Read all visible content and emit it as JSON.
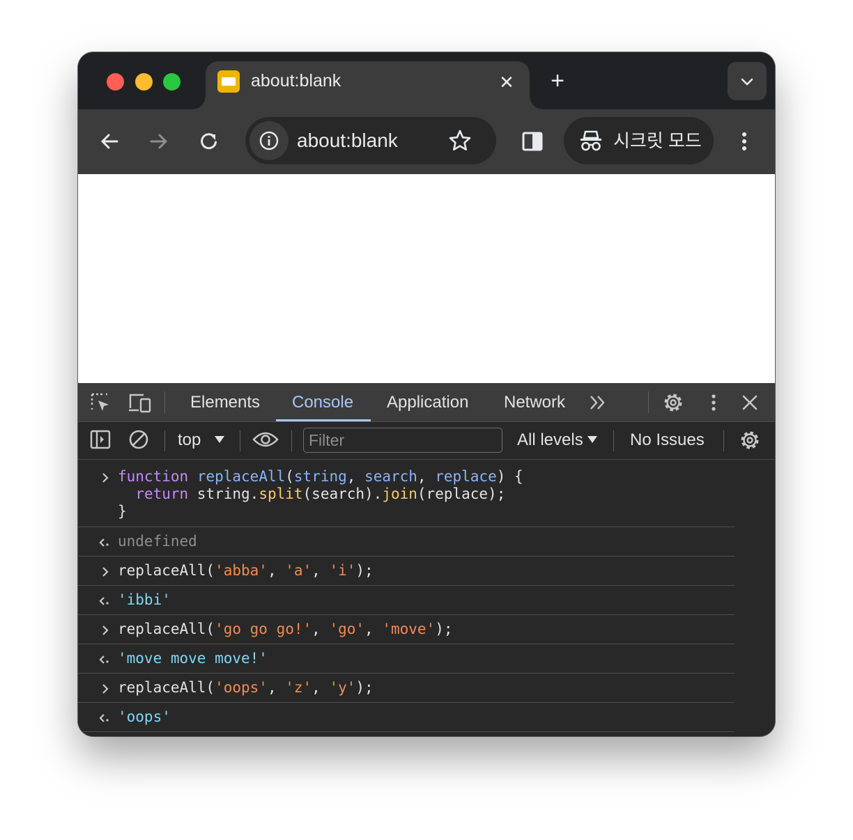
{
  "browser": {
    "tab": {
      "title": "about:blank",
      "close_glyph": "✕",
      "favicon": "page-favicon"
    },
    "new_tab_glyph": "+",
    "omnibox": {
      "url": "about:blank"
    },
    "incognito_label": "시크릿 모드",
    "icons": [
      "back-icon",
      "forward-icon",
      "reload-icon",
      "info-icon",
      "star-icon",
      "side-panel-icon",
      "incognito-icon",
      "more-vert-icon",
      "chevron-down-icon"
    ]
  },
  "devtools": {
    "tabs": [
      {
        "label": "Elements"
      },
      {
        "label": "Console",
        "active": true
      },
      {
        "label": "Application"
      },
      {
        "label": "Network"
      }
    ],
    "console_toolbar": {
      "context": "top",
      "filter_placeholder": "Filter",
      "levels": "All levels",
      "issues": "No Issues"
    },
    "colors": {
      "keyword": "#c58af9",
      "identifier": "#8ab4f8",
      "method": "#f9cb70",
      "string": "#f28b54",
      "result_string": "#80d7f8",
      "undefined": "#8e8e8e",
      "active_tab": "#a8c7fa"
    },
    "console": {
      "entries": [
        {
          "kind": "input",
          "lines": [
            [
              {
                "t": "function",
                "c": "kw"
              },
              {
                "t": " "
              },
              {
                "t": "replaceAll",
                "c": "fn"
              },
              {
                "t": "("
              },
              {
                "t": "string",
                "c": "param"
              },
              {
                "t": ", "
              },
              {
                "t": "search",
                "c": "param"
              },
              {
                "t": ", "
              },
              {
                "t": "replace",
                "c": "param"
              },
              {
                "t": ") {"
              }
            ],
            [
              {
                "t": "  "
              },
              {
                "t": "return",
                "c": "kw"
              },
              {
                "t": " string."
              },
              {
                "t": "split",
                "c": "call"
              },
              {
                "t": "(search)."
              },
              {
                "t": "join",
                "c": "call"
              },
              {
                "t": "(replace);"
              }
            ],
            [
              {
                "t": "}"
              }
            ]
          ]
        },
        {
          "kind": "output",
          "lines": [
            [
              {
                "t": "undefined",
                "c": "undef"
              }
            ]
          ]
        },
        {
          "kind": "input",
          "lines": [
            [
              {
                "t": "replaceAll("
              },
              {
                "t": "'abba'",
                "c": "str"
              },
              {
                "t": ", "
              },
              {
                "t": "'a'",
                "c": "str"
              },
              {
                "t": ", "
              },
              {
                "t": "'i'",
                "c": "str"
              },
              {
                "t": ");"
              }
            ]
          ]
        },
        {
          "kind": "output",
          "lines": [
            [
              {
                "t": "'ibbi'",
                "c": "res"
              }
            ]
          ]
        },
        {
          "kind": "input",
          "lines": [
            [
              {
                "t": "replaceAll("
              },
              {
                "t": "'go go go!'",
                "c": "str"
              },
              {
                "t": ", "
              },
              {
                "t": "'go'",
                "c": "str"
              },
              {
                "t": ", "
              },
              {
                "t": "'move'",
                "c": "str"
              },
              {
                "t": ");"
              }
            ]
          ]
        },
        {
          "kind": "output",
          "lines": [
            [
              {
                "t": "'move move move!'",
                "c": "res"
              }
            ]
          ]
        },
        {
          "kind": "input",
          "lines": [
            [
              {
                "t": "replaceAll("
              },
              {
                "t": "'oops'",
                "c": "str"
              },
              {
                "t": ", "
              },
              {
                "t": "'z'",
                "c": "str"
              },
              {
                "t": ", "
              },
              {
                "t": "'y'",
                "c": "str"
              },
              {
                "t": ");"
              }
            ]
          ]
        },
        {
          "kind": "output",
          "lines": [
            [
              {
                "t": "'oops'",
                "c": "res"
              }
            ]
          ]
        }
      ]
    }
  }
}
